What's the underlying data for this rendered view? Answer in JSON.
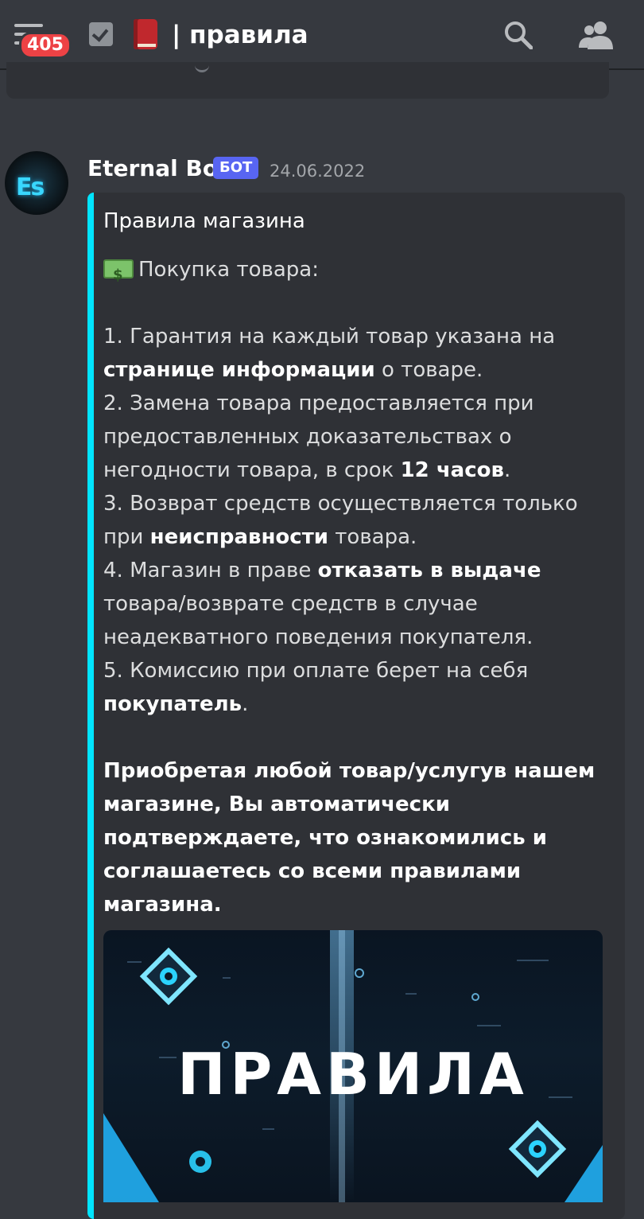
{
  "header": {
    "unread_badge": "405",
    "channel_name": "| правила",
    "icons": [
      "menu-icon",
      "checkbox-channel-icon",
      "book-icon",
      "search-icon",
      "members-icon"
    ]
  },
  "message": {
    "author": "Eternal Bot",
    "bot_tag": "БОТ",
    "timestamp": "24.06.2022",
    "avatar_text": "Es",
    "embed": {
      "accent_color": "#00e5ff",
      "title": "Правила магазина",
      "section_heading": "Покупка товара:",
      "rules": [
        {
          "pre": "1. Гарантия на каждый товар указана на ",
          "bold": "странице информации",
          "post": " о товаре."
        },
        {
          "pre": "2. Замена товара предоставляется при предоставленных доказательствах о негодности товара, в срок ",
          "bold": "12 часов",
          "post": "."
        },
        {
          "pre": "3. Возврат средств осуществляется только при ",
          "bold": "неисправности",
          "post": " товара."
        },
        {
          "pre": "4. Магазин в праве ",
          "bold": "отказать в выдаче",
          "post": " товара/возврате средств в случае неадекватного поведения покупателя."
        },
        {
          "pre": "5. Комиссию при оплате берет на себя ",
          "bold": "покупатель",
          "post": "."
        }
      ],
      "closing": "Приобретая любой товар/услугув нашем магазине, Вы автоматически подтверждаете, что ознакомились и соглашаетесь со всеми правилами магазина.",
      "image_text": "ПРАВИЛА"
    }
  }
}
